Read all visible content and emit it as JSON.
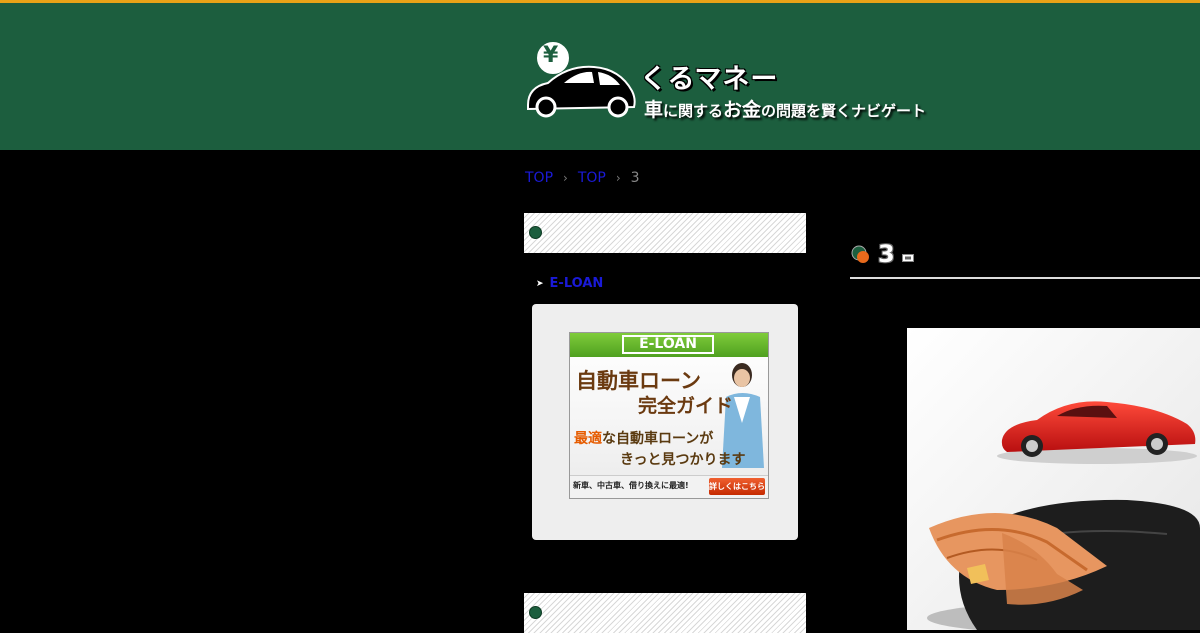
{
  "site": {
    "title": "くるマネー",
    "tagline_parts": [
      "車",
      "に関する",
      "お金",
      "の問題を賢くナビゲート"
    ],
    "yen_symbol": "¥"
  },
  "breadcrumb": {
    "items": [
      "TOP",
      "TOP",
      "3"
    ],
    "separator": "›"
  },
  "sidebar": {
    "link_label": "E-LOAN",
    "ad": {
      "badge": "E-LOAN",
      "line1": "自動車ローン",
      "line2": "完全ガイド",
      "line3_highlight": "最適",
      "line3_rest": "な自動車ローンが",
      "line4": "きっと見つかります",
      "footer_text": "新車、中古車、借り換えに最適!",
      "button": "詳しくはこちら"
    }
  },
  "main": {
    "heading": "3"
  },
  "colors": {
    "header_bg": "#1c5e3e",
    "header_border": "#e8a317",
    "link": "#1a1ad8"
  }
}
